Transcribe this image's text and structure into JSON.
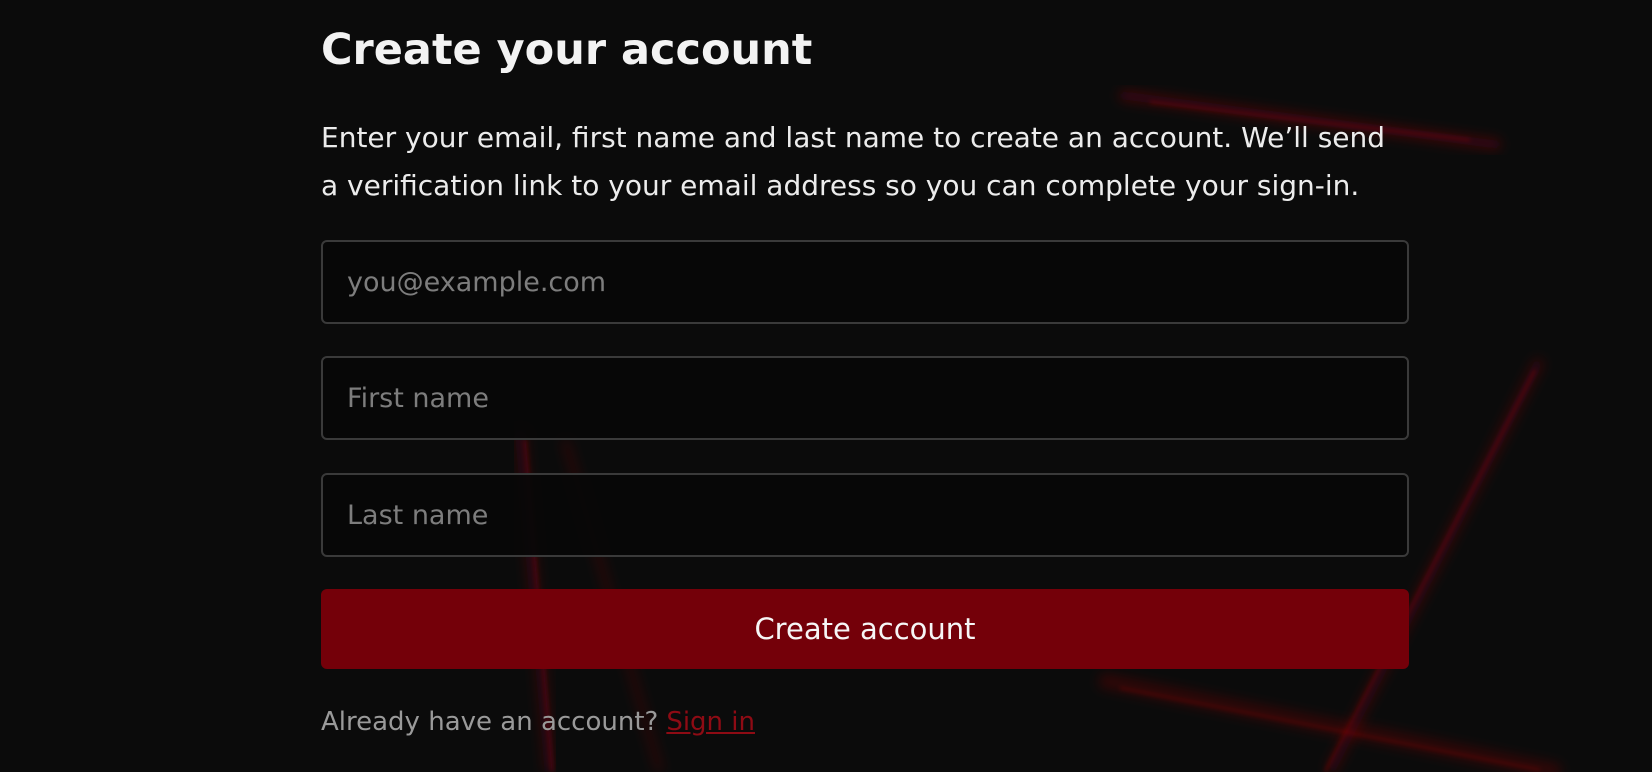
{
  "page": {
    "title": "Create your account",
    "description": "Enter your email, first name and last name to create an account. We’ll send a verification link to your email address so you can complete your sign-in."
  },
  "form": {
    "email": {
      "value": "",
      "placeholder": "you@example.com"
    },
    "first_name": {
      "value": "",
      "placeholder": "First name"
    },
    "last_name": {
      "value": "",
      "placeholder": "Last name"
    },
    "submit_label": "Create account"
  },
  "footer": {
    "prompt": "Already have an account?",
    "link_label": "Sign in"
  },
  "colors": {
    "background": "#0b0b0b",
    "accent": "#740009",
    "link": "#8e0b14",
    "field_border": "#3a3a3a"
  }
}
